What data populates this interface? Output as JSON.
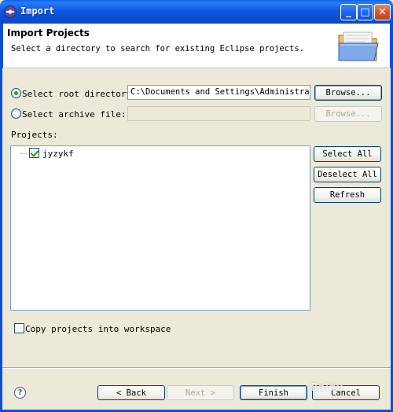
{
  "window": {
    "title": "Import",
    "controls": {
      "minimize": "_",
      "maximize": "□",
      "close": "✕"
    }
  },
  "header": {
    "title": "Import Projects",
    "description": "Select a directory to search for existing Eclipse projects.",
    "icon": "folder-icon"
  },
  "source": {
    "root_label": "Select root directory:",
    "root_selected": true,
    "root_path": "C:\\Documents and Settings\\Administrator'",
    "archive_label": "Select archive file:",
    "archive_selected": false,
    "archive_path": "",
    "browse_label": "Browse...",
    "browse_archive_label": "Browse..."
  },
  "projects": {
    "label": "Projects:",
    "items": [
      {
        "name": "jyzykf",
        "checked": true
      }
    ],
    "select_all_label": "Select All",
    "deselect_all_label": "Deselect All",
    "refresh_label": "Refresh"
  },
  "options": {
    "copy_label": "Copy projects into workspace",
    "copy_checked": false
  },
  "footer": {
    "help_glyph": "?",
    "back_label": "< Back",
    "next_label": "Next >",
    "finish_label": "Finish",
    "cancel_label": "Cancel",
    "watermark": "Baidu"
  }
}
